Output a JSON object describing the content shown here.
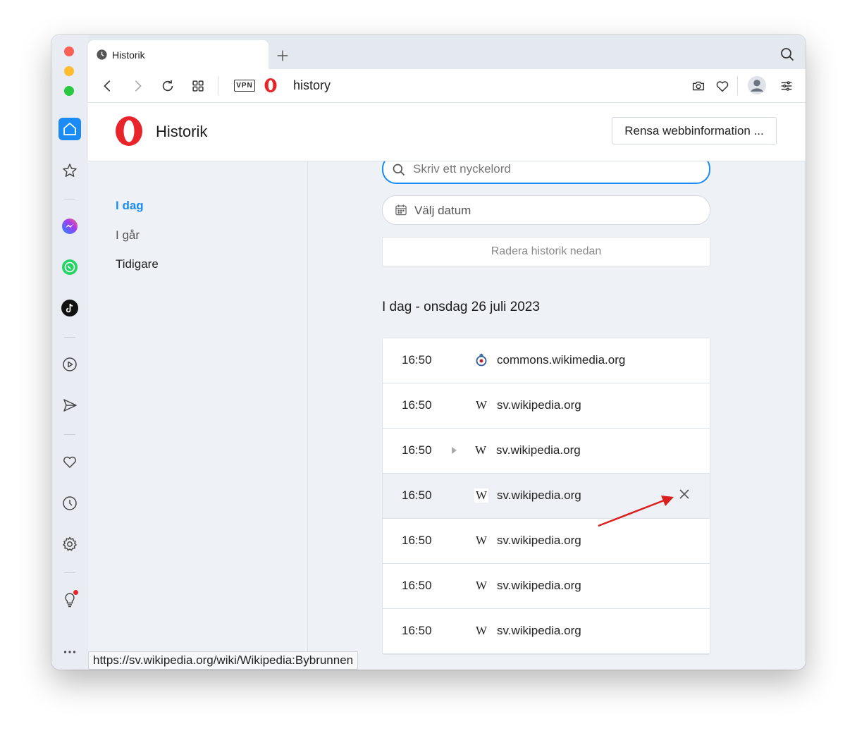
{
  "tab": {
    "title": "Historik",
    "icon": "clock-icon"
  },
  "addressbar": {
    "vpn_label": "VPN",
    "url": "history"
  },
  "header": {
    "title": "Historik",
    "clear_button": "Rensa webbinformation ..."
  },
  "nav": {
    "today": "I dag",
    "yesterday": "I går",
    "earlier": "Tidigare"
  },
  "search": {
    "placeholder": "Skriv ett nyckelord"
  },
  "date_picker": {
    "label": "Välj datum"
  },
  "delete_below": "Radera historik nedan",
  "section_heading": "I dag - onsdag 26 juli 2023",
  "history": [
    {
      "time": "16:50",
      "domain": "commons.wikimedia.org",
      "favicon": "wikimedia-commons-icon"
    },
    {
      "time": "16:50",
      "domain": "sv.wikipedia.org",
      "favicon": "W"
    },
    {
      "time": "16:50",
      "domain": "sv.wikipedia.org",
      "favicon": "W",
      "expandable": true
    },
    {
      "time": "16:50",
      "domain": "sv.wikipedia.org",
      "favicon": "W",
      "hovered": true
    },
    {
      "time": "16:50",
      "domain": "sv.wikipedia.org",
      "favicon": "W"
    },
    {
      "time": "16:50",
      "domain": "sv.wikipedia.org",
      "favicon": "W"
    },
    {
      "time": "16:50",
      "domain": "sv.wikipedia.org",
      "favicon": "W"
    }
  ],
  "status_url": "https://sv.wikipedia.org/wiki/Wikipedia:Bybrunnen",
  "colors": {
    "accent": "#1b8cf5",
    "opera_red": "#e8242a",
    "annotation_arrow": "#d9201f"
  }
}
